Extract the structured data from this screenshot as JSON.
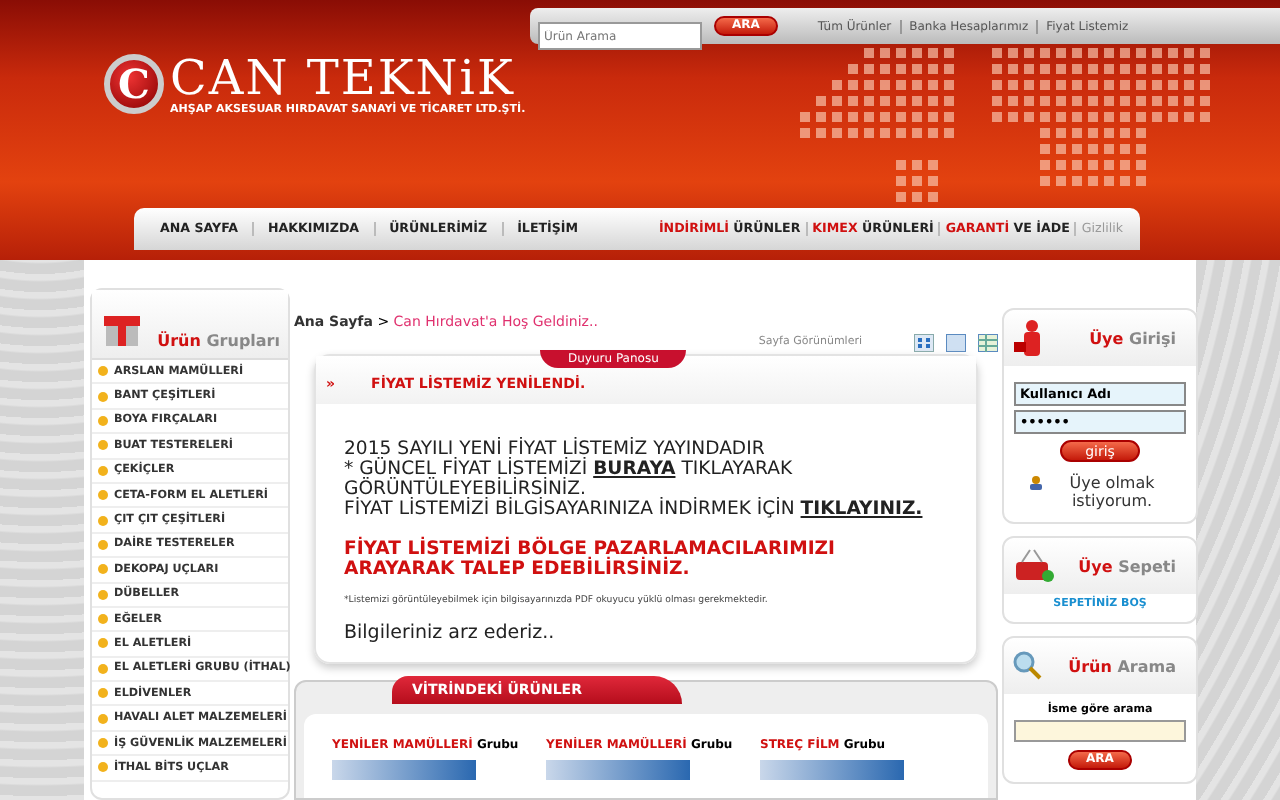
{
  "top_bar": {
    "search": {
      "placeholder": "Ürün Arama"
    },
    "search_button": "ARA",
    "links": [
      "Tüm Ürünler",
      "Banka Hesaplarımız",
      "Fiyat Listemiz"
    ]
  },
  "logo": {
    "letter": "C",
    "name": "CAN TEKNiK",
    "subtitle": "AHŞAP AKSESUAR HIRDAVAT SANAYİ VE TİCARET LTD.ŞTİ."
  },
  "nav": {
    "left": [
      "ANA SAYFA",
      "HAKKIMIZDA",
      "ÜRÜNLERİMİZ",
      "İLETİŞİM"
    ],
    "right": [
      {
        "kind": "split",
        "accent": "İNDİRİMLİ",
        "label": "ÜRÜNLER"
      },
      {
        "kind": "split",
        "accent": "KIMEX",
        "label": "ÜRÜNLERİ"
      },
      {
        "kind": "split",
        "accent": "GARANTİ",
        "label": "VE İADE"
      },
      {
        "kind": "muted",
        "label": "Gizlilik"
      }
    ]
  },
  "sidebar": {
    "title_accent": "Ürün",
    "title": "Grupları",
    "items": [
      "ARSLAN MAMÜLLERİ",
      "BANT ÇEŞİTLERİ",
      "BOYA FIRÇALARI",
      "BUAT TESTERELERİ",
      "ÇEKİÇLER",
      "CETA-FORM EL ALETLERİ",
      "ÇIT ÇIT ÇEŞİTLERİ",
      "DAİRE TESTERELER",
      "DEKOPAJ UÇLARI",
      "DÜBELLER",
      "EĞELER",
      "EL ALETLERİ",
      "EL ALETLERİ GRUBU (İTHAL)",
      "ELDİVENLER",
      "HAVALI ALET MALZEMELERİ",
      "İŞ GÜVENLİK MALZEMELERİ",
      "İTHAL BİTS UÇLAR"
    ]
  },
  "breadcrumb": {
    "home": "Ana Sayfa",
    "separator": ">",
    "current": "Can Hırdavat'a Hoş Geldiniz.."
  },
  "view_options": {
    "label": "Sayfa Görünümleri"
  },
  "announcement": {
    "tab": "Duyuru Panosu",
    "bullet": "»",
    "headline": "FİYAT LİSTEMİZ YENİLENDİ.",
    "lines": [
      {
        "before": "2015 SAYILI YENİ FİYAT LİSTEMİZ YAYINDADIR"
      },
      {
        "before": "* GÜNCEL FİYAT LİSTEMİZİ ",
        "link": "BURAYA",
        "after": " TIKLAYARAK GÖRÜNTÜLEYEBİLİRSİNİZ."
      },
      {
        "before": "FİYAT LİSTEMİZİ BİLGİSAYARINIZA İNDİRMEK İÇİN ",
        "link": "TIKLAYINIZ."
      }
    ],
    "notice": "FİYAT LİSTEMİZİ BÖLGE PAZARLAMACILARIMIZI ARAYARAK TALEP EDEBİLİRSİNİZ.",
    "footnote": "*Listemizi görüntüleyebilmek için bilgisayarınızda PDF okuyucu yüklü olması gerekmektedir.",
    "closing": "Bilgileriniz arz ederiz.."
  },
  "showcase": {
    "title": "VİTRİNDEKİ ÜRÜNLER",
    "products": [
      {
        "name": "YENİLER MAMÜLLERİ",
        "group": "Grubu"
      },
      {
        "name": "YENİLER MAMÜLLERİ",
        "group": "Grubu"
      },
      {
        "name": "STREÇ FİLM",
        "group": "Grubu"
      }
    ]
  },
  "login": {
    "title_accent": "Üye",
    "title": "Girişi",
    "username": "Kullanıcı Adı",
    "password": "••••••",
    "button": "giriş",
    "register": "Üye olmak istiyorum."
  },
  "cart": {
    "title_accent": "Üye",
    "title": "Sepeti",
    "status": "SEPETİNİZ BOŞ"
  },
  "product_search": {
    "title_accent": "Ürün",
    "title": "Arama",
    "label": "İsme göre arama",
    "button": "ARA"
  }
}
